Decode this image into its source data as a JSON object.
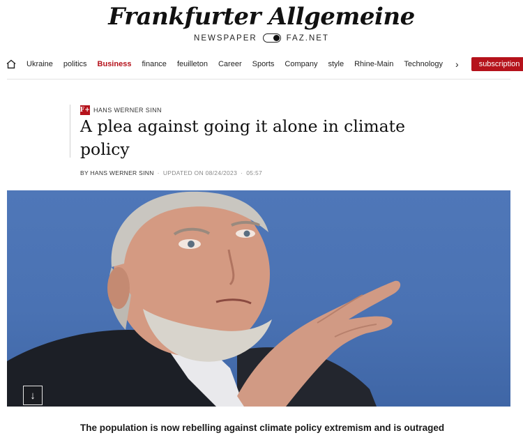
{
  "header": {
    "logo": "Frankfurter Allgemeine",
    "edition_left": "NEWSPAPER",
    "edition_right": "FAZ.NET"
  },
  "nav": {
    "items": [
      "Ukraine",
      "politics",
      "Business",
      "finance",
      "feuilleton",
      "Career",
      "Sports",
      "Company",
      "style",
      "Rhine-Main",
      "Technology"
    ],
    "active": "Business",
    "more_icon": "chevron-right-icon",
    "home_icon": "home-icon",
    "subscribe": "subscription"
  },
  "article": {
    "section_badge": "F+",
    "author_tag": "HANS WERNER SINN",
    "title": "A plea against going it alone in climate policy",
    "byline_by": "BY HANS WERNER SINN",
    "byline_updated": "UPDATED ON 08/24/2023",
    "byline_time": "05:57",
    "lead": "The population is now rebelling against climate policy extremism and is outraged"
  },
  "colors": {
    "brand_red": "#b5121b",
    "hero_background": "#4a72b3"
  },
  "icons": {
    "scroll_down": "arrow-down-icon"
  }
}
